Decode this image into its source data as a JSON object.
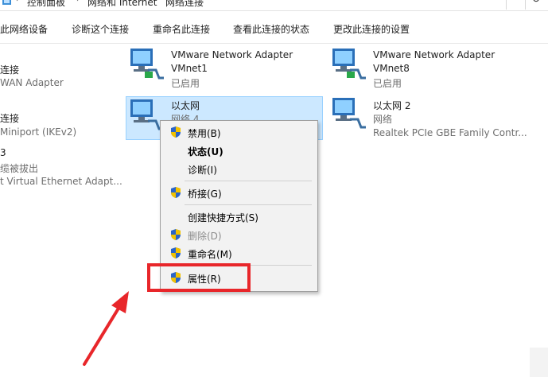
{
  "breadcrumb": {
    "items": [
      "控制面板",
      "网络和 Internet",
      "网络连接"
    ]
  },
  "toolbar": {
    "disable_device": "此网络设备",
    "diagnose": "诊断这个连接",
    "rename": "重命名此连接",
    "view_status": "查看此连接的状态",
    "change_settings": "更改此连接的设置"
  },
  "left_items": [
    {
      "line1": "连接",
      "line2": "WAN Adapter"
    },
    {
      "line1": "连接",
      "line2": "Miniport (IKEv2)"
    },
    {
      "line1": "3",
      "line2": "缆被拔出",
      "line3": "t Virtual Ethernet Adapt..."
    }
  ],
  "adapters": {
    "vmnet1": {
      "name": "VMware Network Adapter",
      "name2": "VMnet1",
      "status": "已启用"
    },
    "vmnet8": {
      "name": "VMware Network Adapter",
      "name2": "VMnet8",
      "status": "已启用"
    },
    "eth": {
      "name": "以太网",
      "status": "网络 4"
    },
    "eth2": {
      "name": "以太网 2",
      "status": "网络",
      "device": "Realtek PCIe GBE Family Contr..."
    }
  },
  "context_menu": {
    "disable": "禁用(B)",
    "status": "状态(U)",
    "diagnose": "诊断(I)",
    "bridge": "桥接(G)",
    "shortcut": "创建快捷方式(S)",
    "delete": "删除(D)",
    "rename": "重命名(M)",
    "properties": "属性(R)"
  },
  "colors": {
    "selection": "#cce8ff",
    "highlight_red": "#e8262a",
    "menu_bg": "#f2f2f2"
  }
}
